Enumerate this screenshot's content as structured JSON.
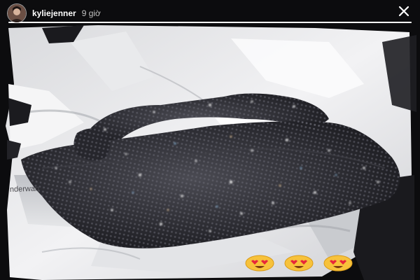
{
  "story": {
    "username": "kyliejenner",
    "time_ago": "9 giờ",
    "progress": 1.0
  },
  "photo": {
    "box_text": "nderwan"
  },
  "reactions": [
    {
      "emoji": "heart-eyes"
    },
    {
      "emoji": "heart-eyes"
    },
    {
      "emoji": "heart-eyes"
    }
  ],
  "colors": {
    "accent": "#ffffff",
    "bag": "#2e2e35"
  }
}
